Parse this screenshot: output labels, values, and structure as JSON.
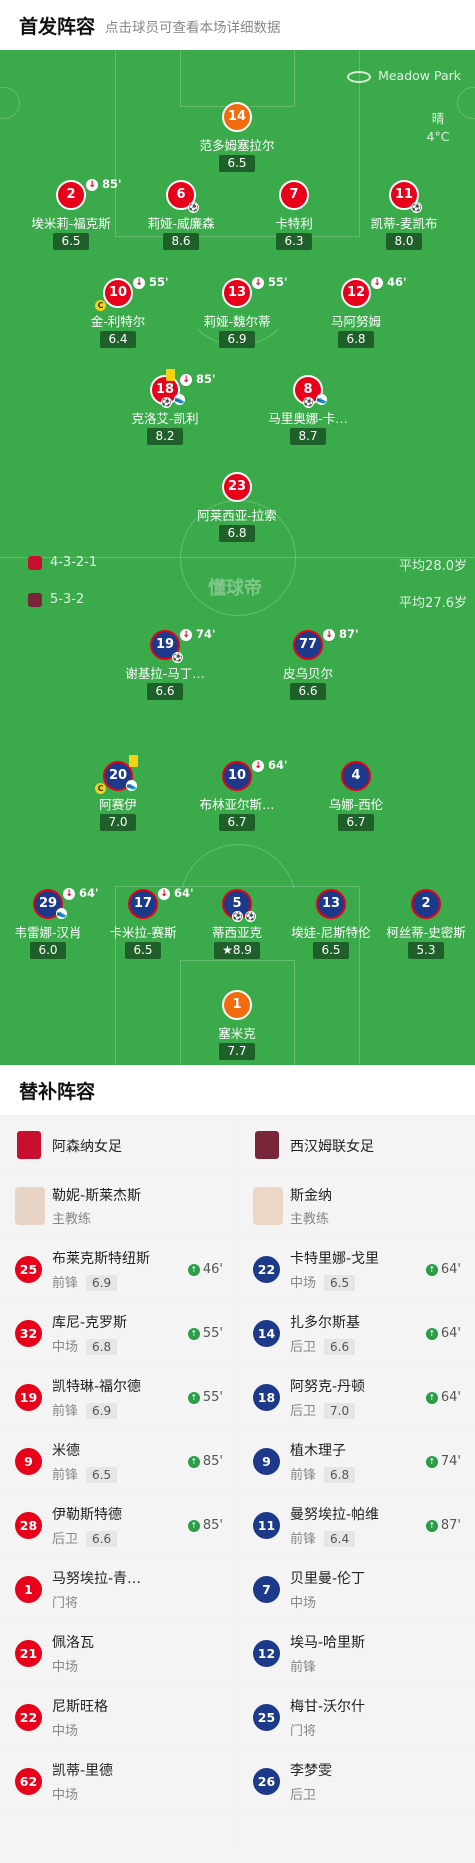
{
  "header": {
    "title": "首发阵容",
    "subtitle": "点击球员可查看本场详细数据"
  },
  "pitch": {
    "venue": "Meadow Park",
    "weather": {
      "cond": "晴",
      "temp": "4°C"
    },
    "watermark": "懂球帝",
    "home": {
      "formation": "4-3-2-1",
      "avg_age": "平均28.0岁",
      "color": "#e8001a"
    },
    "away": {
      "formation": "5-3-2",
      "avg_age": "平均27.6岁",
      "color": "#1d3a8a"
    }
  },
  "players": {
    "h14": {
      "num": "14",
      "name": "范多姆塞拉尔",
      "rating": "6.5"
    },
    "h2": {
      "num": "2",
      "name": "埃米莉-福克斯",
      "rating": "6.5",
      "sub": "85'"
    },
    "h6": {
      "num": "6",
      "name": "莉娅-威廉森",
      "rating": "8.6"
    },
    "h7": {
      "num": "7",
      "name": "卡特利",
      "rating": "6.3"
    },
    "h11": {
      "num": "11",
      "name": "凯蒂-麦凯布",
      "rating": "8.0"
    },
    "h10": {
      "num": "10",
      "name": "金-利特尔",
      "rating": "6.4",
      "sub": "55'"
    },
    "h13": {
      "num": "13",
      "name": "莉娅-魏尔蒂",
      "rating": "6.9",
      "sub": "55'"
    },
    "h12": {
      "num": "12",
      "name": "马阿努姆",
      "rating": "6.8",
      "sub": "46'"
    },
    "h18": {
      "num": "18",
      "name": "克洛艾-凯利",
      "rating": "8.2",
      "sub": "85'"
    },
    "h8": {
      "num": "8",
      "name": "马里奥娜-卡…",
      "rating": "8.7"
    },
    "h23": {
      "num": "23",
      "name": "阿莱西亚-拉索",
      "rating": "6.8"
    },
    "a19": {
      "num": "19",
      "name": "谢基拉-马丁…",
      "rating": "6.6",
      "sub": "74'"
    },
    "a77": {
      "num": "77",
      "name": "皮乌贝尔",
      "rating": "6.6",
      "sub": "87'"
    },
    "a20": {
      "num": "20",
      "name": "阿赛伊",
      "rating": "7.0"
    },
    "a10": {
      "num": "10",
      "name": "布林亚尔斯…",
      "rating": "6.7",
      "sub": "64'"
    },
    "a4": {
      "num": "4",
      "name": "乌娜-西伦",
      "rating": "6.7"
    },
    "a29": {
      "num": "29",
      "name": "韦雷娜-汉肖",
      "rating": "6.0",
      "sub": "64'"
    },
    "a17": {
      "num": "17",
      "name": "卡米拉-赛斯",
      "rating": "6.5",
      "sub": "64'"
    },
    "a5": {
      "num": "5",
      "name": "蒂西亚克",
      "rating": "8.9"
    },
    "a13": {
      "num": "13",
      "name": "埃娃-尼斯特伦",
      "rating": "6.5"
    },
    "a2": {
      "num": "2",
      "name": "柯丝蒂-史密斯",
      "rating": "5.3"
    },
    "a1": {
      "num": "1",
      "name": "塞米克",
      "rating": "7.7"
    }
  },
  "subs": {
    "title": "替补阵容",
    "home": {
      "team": "阿森纳女足",
      "coach": {
        "name": "勒妮-斯莱杰斯",
        "role": "主教练"
      },
      "list": [
        {
          "num": "25",
          "name": "布莱克斯特纽斯",
          "pos": "前锋",
          "rating": "6.9",
          "on": "46'"
        },
        {
          "num": "32",
          "name": "库尼-克罗斯",
          "pos": "中场",
          "rating": "6.8",
          "on": "55'"
        },
        {
          "num": "19",
          "name": "凯特琳-福尔德",
          "pos": "前锋",
          "rating": "6.9",
          "on": "55'"
        },
        {
          "num": "9",
          "name": "米德",
          "pos": "前锋",
          "rating": "6.5",
          "on": "85'"
        },
        {
          "num": "28",
          "name": "伊勒斯特德",
          "pos": "后卫",
          "rating": "6.6",
          "on": "85'"
        },
        {
          "num": "1",
          "name": "马努埃拉-青…",
          "pos": "门将",
          "rating": "",
          "on": ""
        },
        {
          "num": "21",
          "name": "佩洛瓦",
          "pos": "中场",
          "rating": "",
          "on": ""
        },
        {
          "num": "22",
          "name": "尼斯旺格",
          "pos": "中场",
          "rating": "",
          "on": ""
        },
        {
          "num": "62",
          "name": "凯蒂-里德",
          "pos": "中场",
          "rating": "",
          "on": ""
        }
      ]
    },
    "away": {
      "team": "西汉姆联女足",
      "coach": {
        "name": "斯金纳",
        "role": "主教练"
      },
      "list": [
        {
          "num": "22",
          "name": "卡特里娜-戈里",
          "pos": "中场",
          "rating": "6.5",
          "on": "64'"
        },
        {
          "num": "14",
          "name": "扎多尔斯基",
          "pos": "后卫",
          "rating": "6.6",
          "on": "64'"
        },
        {
          "num": "18",
          "name": "阿努克-丹顿",
          "pos": "后卫",
          "rating": "7.0",
          "on": "64'"
        },
        {
          "num": "9",
          "name": "植木理子",
          "pos": "前锋",
          "rating": "6.8",
          "on": "74'"
        },
        {
          "num": "11",
          "name": "曼努埃拉-帕维",
          "pos": "前锋",
          "rating": "6.4",
          "on": "87'"
        },
        {
          "num": "7",
          "name": "贝里曼-伦丁",
          "pos": "中场",
          "rating": "",
          "on": ""
        },
        {
          "num": "12",
          "name": "埃马-哈里斯",
          "pos": "前锋",
          "rating": "",
          "on": ""
        },
        {
          "num": "25",
          "name": "梅甘-沃尔什",
          "pos": "门将",
          "rating": "",
          "on": ""
        },
        {
          "num": "26",
          "name": "李梦雯",
          "pos": "后卫",
          "rating": "",
          "on": ""
        }
      ]
    }
  }
}
